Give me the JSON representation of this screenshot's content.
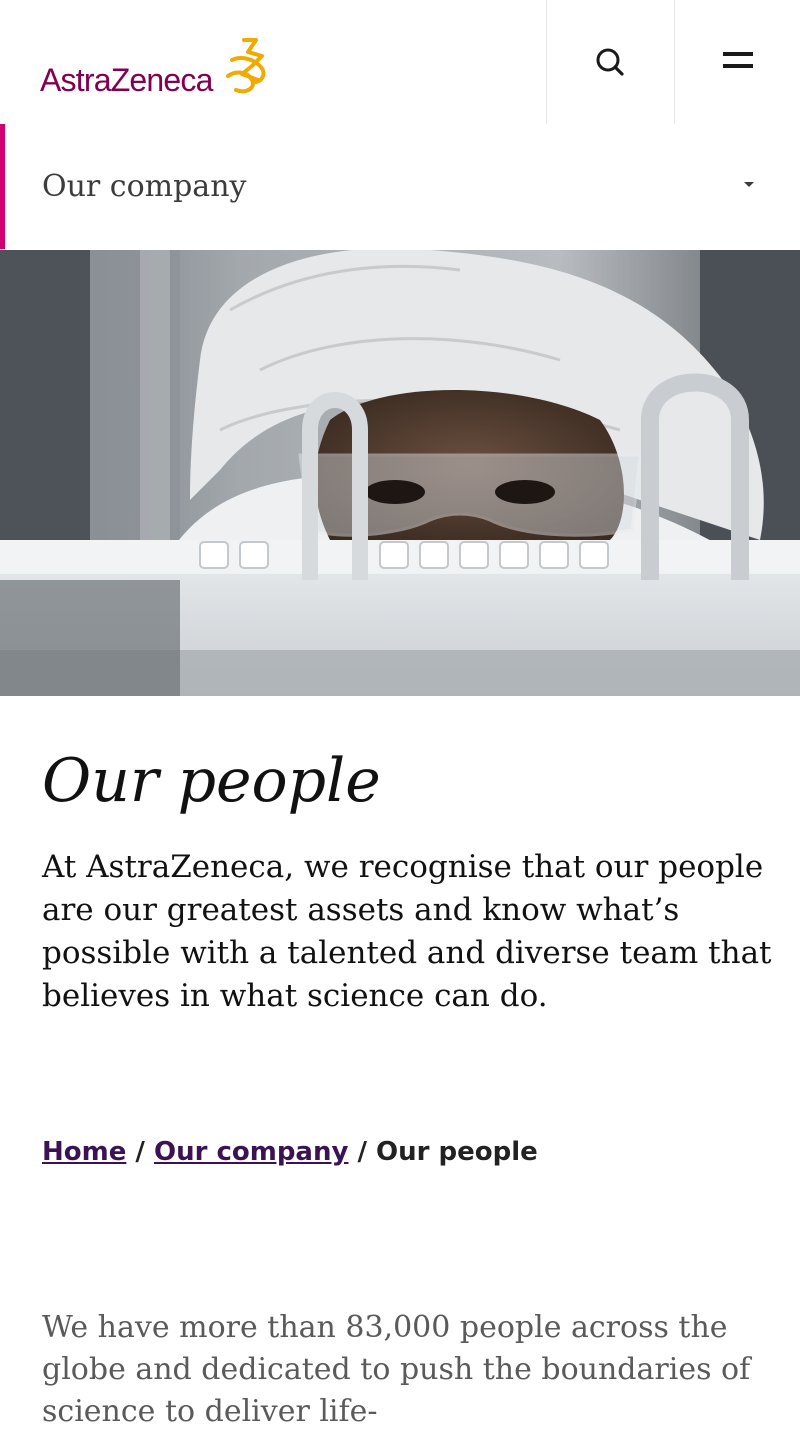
{
  "header": {
    "logo_text": "AstraZeneca",
    "brand_color": "#830051",
    "logo_accent_color": "#efab00",
    "search_icon": "search-icon",
    "menu_icon": "hamburger-menu-icon"
  },
  "subnav": {
    "label": "Our company",
    "accent_color": "#d0006f"
  },
  "hero": {
    "image": "lab-technician-with-hairnet-and-safety-glasses-photo"
  },
  "page": {
    "title": "Our people",
    "intro": "At AstraZeneca, we recognise that our people are our greatest assets and know what’s possible with a talented and diverse team that believes in what science can do.",
    "body": "We have more than 83,000 people across the globe and dedicated to push the boundaries of science to deliver life-"
  },
  "breadcrumb": {
    "items": [
      "Home",
      "Our company"
    ],
    "current": "Our people",
    "separator": " / "
  }
}
